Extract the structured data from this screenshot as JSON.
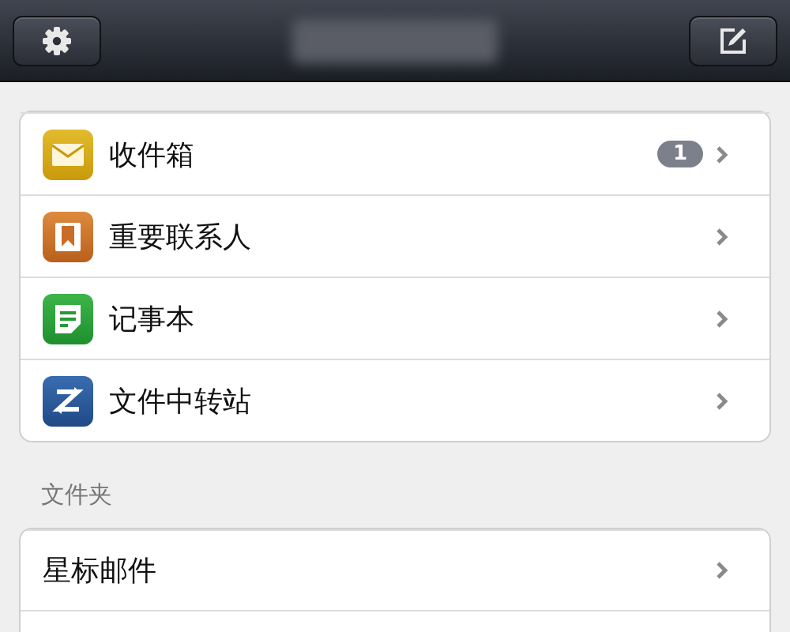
{
  "nav_bar": {
    "left_button": {
      "kind": "settings"
    },
    "right_button": {
      "kind": "compose"
    },
    "title": {
      "kind": "blurred"
    }
  },
  "accounts": [
    {
      "kind": "mail",
      "label": "收件箱",
      "badge": "1"
    },
    {
      "kind": "bookmark",
      "label": "重要联系人"
    },
    {
      "kind": "note",
      "label": "记事本"
    },
    {
      "kind": "transfer",
      "label": "文件中转站"
    }
  ],
  "folders": {
    "header": "文件夹",
    "items": [
      {
        "label": "星标邮件"
      }
    ]
  }
}
